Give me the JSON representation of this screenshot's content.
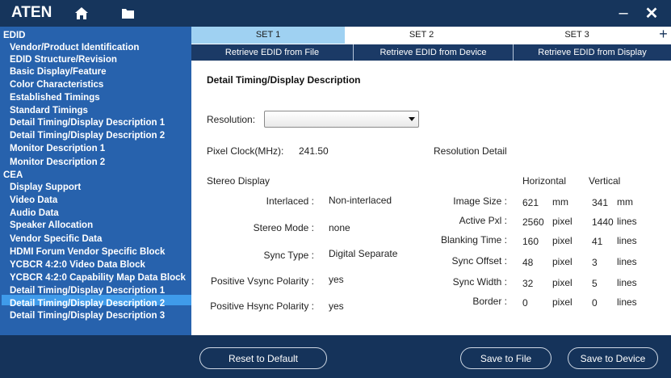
{
  "app": {
    "brand": "ATEN",
    "min_glyph": "–",
    "close_glyph": "✕"
  },
  "sidebar": {
    "items": [
      {
        "label": "EDID",
        "type": "head"
      },
      {
        "label": "Vendor/Product Identification"
      },
      {
        "label": "EDID Structure/Revision"
      },
      {
        "label": "Basic Display/Feature"
      },
      {
        "label": "Color Characteristics"
      },
      {
        "label": "Established Timings"
      },
      {
        "label": "Standard Timings"
      },
      {
        "label": "Detail Timing/Display Description 1"
      },
      {
        "label": "Detail Timing/Display Description 2"
      },
      {
        "label": "Monitor Description 1"
      },
      {
        "label": "Monitor Description 2"
      },
      {
        "label": "CEA",
        "type": "head"
      },
      {
        "label": "Display Support"
      },
      {
        "label": "Video Data"
      },
      {
        "label": "Audio Data"
      },
      {
        "label": "Speaker Allocation"
      },
      {
        "label": "Vendor Specific Data"
      },
      {
        "label": "HDMI Forum Vendor Specific Block"
      },
      {
        "label": "YCBCR 4:2:0 Video Data Block"
      },
      {
        "label": "YCBCR 4:2:0 Capability Map Data Block"
      },
      {
        "label": "Detail Timing/Display Description 1",
        "selected": true
      },
      {
        "label": "Detail Timing/Display Description 2"
      },
      {
        "label": "Detail Timing/Display Description 3"
      }
    ]
  },
  "tabs": [
    {
      "label": "SET 1",
      "active": true
    },
    {
      "label": "SET 2"
    },
    {
      "label": "SET 3"
    }
  ],
  "tab_add": "+",
  "retrieve": [
    {
      "label": "Retrieve EDID from File"
    },
    {
      "label": "Retrieve EDID from Device"
    },
    {
      "label": "Retrieve EDID from Display"
    }
  ],
  "section_title": "Detail Timing/Display Description",
  "resolution": {
    "label": "Resolution:",
    "value": ""
  },
  "pixel_clock": {
    "label": "Pixel Clock(MHz):",
    "value": "241.50"
  },
  "resolution_detail_label": "Resolution Detail",
  "stereo_display_label": "Stereo Display",
  "left_fields": [
    {
      "label": "Interlaced :",
      "value": "Non-interlaced"
    },
    {
      "label": "Stereo Mode :",
      "value": "none"
    },
    {
      "label": "Sync Type :",
      "value": "Digital Separate"
    },
    {
      "label": "Positive Vsync Polarity :",
      "value": "yes"
    },
    {
      "label": "Positive Hsync Polarity :",
      "value": "yes"
    }
  ],
  "detail_headers": {
    "horizontal": "Horizontal",
    "vertical": "Vertical"
  },
  "detail_rows": [
    {
      "label": "Image Size :",
      "h": "621",
      "h_unit": "mm",
      "v": "341",
      "v_unit": "mm"
    },
    {
      "label": "Active Pxl :",
      "h": "2560",
      "h_unit": "pixel",
      "v": "1440",
      "v_unit": "lines"
    },
    {
      "label": "Blanking Time :",
      "h": "160",
      "h_unit": "pixel",
      "v": "41",
      "v_unit": "lines"
    },
    {
      "label": "Sync Offset :",
      "h": "48",
      "h_unit": "pixel",
      "v": "3",
      "v_unit": "lines"
    },
    {
      "label": "Sync Width :",
      "h": "32",
      "h_unit": "pixel",
      "v": "5",
      "v_unit": "lines"
    },
    {
      "label": "Border :",
      "h": "0",
      "h_unit": "pixel",
      "v": "0",
      "v_unit": "lines"
    }
  ],
  "footer": {
    "reset": "Reset to Default",
    "save_file": "Save to File",
    "save_device": "Save to Device"
  },
  "icons": {
    "home": "home-icon",
    "folder": "folder-icon"
  }
}
